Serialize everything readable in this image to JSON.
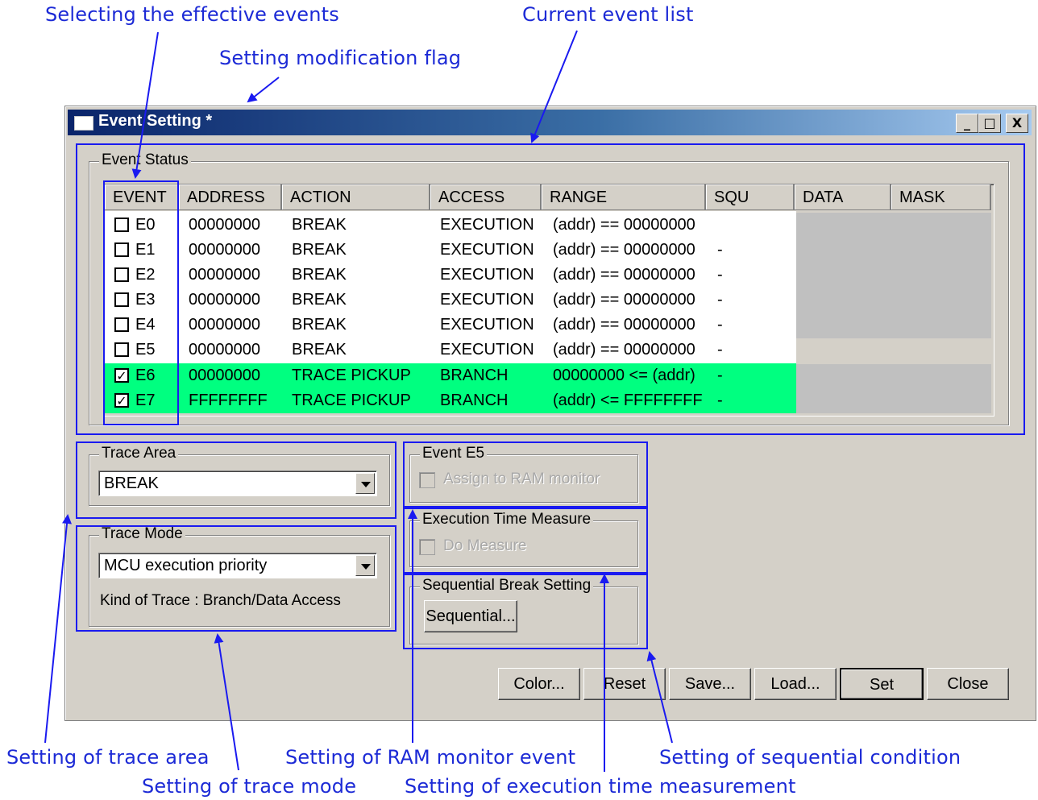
{
  "callouts": {
    "effective_events": "Selecting the effective events",
    "current_event_list": "Current event list",
    "modification_flag": "Setting modification flag",
    "trace_area": "Setting of trace area",
    "trace_mode": "Setting of trace mode",
    "ram_monitor": "Setting of RAM monitor event",
    "exec_time": "Setting of execution time measurement",
    "sequential": "Setting of sequential condition"
  },
  "window": {
    "title": "Event Setting *",
    "controls": [
      "_",
      "□",
      "X"
    ]
  },
  "event_status": {
    "label": "Event Status",
    "columns": [
      "EVENT",
      "ADDRESS",
      "ACTION",
      "ACCESS",
      "RANGE",
      "SQU",
      "DATA",
      "MASK"
    ],
    "rows": [
      {
        "checked": false,
        "event": "E0",
        "address": "00000000",
        "action": "BREAK",
        "access": "EXECUTION",
        "range": "(addr) == 00000000",
        "squ": "",
        "highlight": false
      },
      {
        "checked": false,
        "event": "E1",
        "address": "00000000",
        "action": "BREAK",
        "access": "EXECUTION",
        "range": "(addr) == 00000000",
        "squ": "-",
        "highlight": false
      },
      {
        "checked": false,
        "event": "E2",
        "address": "00000000",
        "action": "BREAK",
        "access": "EXECUTION",
        "range": "(addr) == 00000000",
        "squ": "-",
        "highlight": false
      },
      {
        "checked": false,
        "event": "E3",
        "address": "00000000",
        "action": "BREAK",
        "access": "EXECUTION",
        "range": "(addr) == 00000000",
        "squ": "-",
        "highlight": false
      },
      {
        "checked": false,
        "event": "E4",
        "address": "00000000",
        "action": "BREAK",
        "access": "EXECUTION",
        "range": "(addr) == 00000000",
        "squ": "-",
        "highlight": false
      },
      {
        "checked": false,
        "event": "E5",
        "address": "00000000",
        "action": "BREAK",
        "access": "EXECUTION",
        "range": "(addr) == 00000000",
        "squ": "-",
        "highlight": false
      },
      {
        "checked": true,
        "event": "E6",
        "address": "00000000",
        "action": "TRACE PICKUP",
        "access": "BRANCH",
        "range": "00000000 <= (addr)",
        "squ": "-",
        "highlight": true
      },
      {
        "checked": true,
        "event": "E7",
        "address": "FFFFFFFF",
        "action": "TRACE PICKUP",
        "access": "BRANCH",
        "range": "(addr) <= FFFFFFFF",
        "squ": "-",
        "highlight": true
      }
    ]
  },
  "trace_area": {
    "label": "Trace Area",
    "value": "BREAK"
  },
  "trace_mode": {
    "label": "Trace Mode",
    "value": "MCU execution priority",
    "kind": "Kind of Trace : Branch/Data Access"
  },
  "event_e5": {
    "label": "Event E5",
    "checkbox": "Assign to RAM monitor"
  },
  "exec_time": {
    "label": "Execution Time Measure",
    "checkbox": "Do Measure"
  },
  "sequential": {
    "label": "Sequential Break Setting",
    "button": "Sequential..."
  },
  "buttons": {
    "color": "Color...",
    "reset": "Reset",
    "save": "Save...",
    "load": "Load...",
    "set": "Set",
    "close": "Close"
  },
  "colors": {
    "highlight": "#00ff80",
    "callout": "#1c2ad6",
    "dialog": "#d4d0c8"
  }
}
